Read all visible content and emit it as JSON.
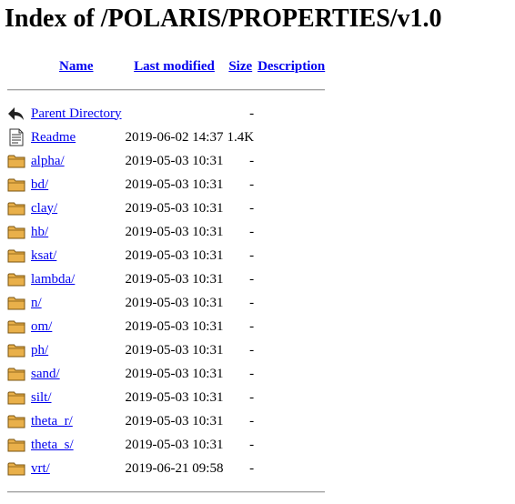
{
  "page": {
    "title": "Index of /POLARIS/PROPERTIES/v1.0"
  },
  "table": {
    "headers": {
      "name": "Name",
      "last_modified": "Last modified",
      "size": "Size",
      "description": "Description"
    },
    "rows": [
      {
        "icon": "back-arrow-icon",
        "name": "Parent Directory",
        "date": "",
        "size": "-",
        "description": ""
      },
      {
        "icon": "text-file-icon",
        "name": "Readme",
        "date": "2019-06-02 14:37",
        "size": "1.4K",
        "description": ""
      },
      {
        "icon": "folder-icon",
        "name": "alpha/",
        "date": "2019-05-03 10:31",
        "size": "-",
        "description": ""
      },
      {
        "icon": "folder-icon",
        "name": "bd/",
        "date": "2019-05-03 10:31",
        "size": "-",
        "description": ""
      },
      {
        "icon": "folder-icon",
        "name": "clay/",
        "date": "2019-05-03 10:31",
        "size": "-",
        "description": ""
      },
      {
        "icon": "folder-icon",
        "name": "hb/",
        "date": "2019-05-03 10:31",
        "size": "-",
        "description": ""
      },
      {
        "icon": "folder-icon",
        "name": "ksat/",
        "date": "2019-05-03 10:31",
        "size": "-",
        "description": ""
      },
      {
        "icon": "folder-icon",
        "name": "lambda/",
        "date": "2019-05-03 10:31",
        "size": "-",
        "description": ""
      },
      {
        "icon": "folder-icon",
        "name": "n/",
        "date": "2019-05-03 10:31",
        "size": "-",
        "description": ""
      },
      {
        "icon": "folder-icon",
        "name": "om/",
        "date": "2019-05-03 10:31",
        "size": "-",
        "description": ""
      },
      {
        "icon": "folder-icon",
        "name": "ph/",
        "date": "2019-05-03 10:31",
        "size": "-",
        "description": ""
      },
      {
        "icon": "folder-icon",
        "name": "sand/",
        "date": "2019-05-03 10:31",
        "size": "-",
        "description": ""
      },
      {
        "icon": "folder-icon",
        "name": "silt/",
        "date": "2019-05-03 10:31",
        "size": "-",
        "description": ""
      },
      {
        "icon": "folder-icon",
        "name": "theta_r/",
        "date": "2019-05-03 10:31",
        "size": "-",
        "description": ""
      },
      {
        "icon": "folder-icon",
        "name": "theta_s/",
        "date": "2019-05-03 10:31",
        "size": "-",
        "description": ""
      },
      {
        "icon": "folder-icon",
        "name": "vrt/",
        "date": "2019-06-21 09:58",
        "size": "-",
        "description": ""
      }
    ]
  },
  "colors": {
    "link": "#0000ee",
    "folder_fill": "#e9b04a",
    "folder_stroke": "#7a5410"
  }
}
